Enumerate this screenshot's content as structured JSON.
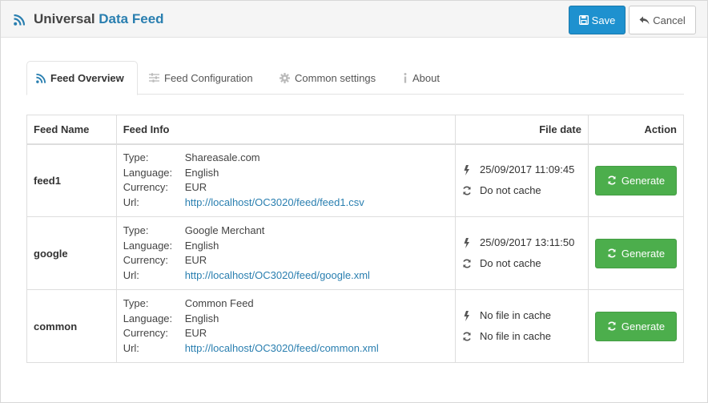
{
  "header": {
    "title_main": "Universal",
    "title_accent": "Data Feed",
    "save_label": "Save",
    "cancel_label": "Cancel"
  },
  "tabs": [
    {
      "label": "Feed Overview",
      "icon": "rss-icon",
      "active": true
    },
    {
      "label": "Feed Configuration",
      "icon": "sliders-icon",
      "active": false
    },
    {
      "label": "Common settings",
      "icon": "gear-icon",
      "active": false
    },
    {
      "label": "About",
      "icon": "info-icon",
      "active": false
    }
  ],
  "table": {
    "columns": [
      "Feed Name",
      "Feed Info",
      "File date",
      "Action"
    ],
    "info_labels": {
      "type": "Type:",
      "language": "Language:",
      "currency": "Currency:",
      "url": "Url:"
    },
    "generate_label": "Generate",
    "rows": [
      {
        "name": "feed1",
        "type": "Shareasale.com",
        "language": "English",
        "currency": "EUR",
        "url": "http://localhost/OC3020/feed/feed1.csv",
        "file_date": "25/09/2017 11:09:45",
        "cache": "Do not cache"
      },
      {
        "name": "google",
        "type": "Google Merchant",
        "language": "English",
        "currency": "EUR",
        "url": "http://localhost/OC3020/feed/google.xml",
        "file_date": "25/09/2017 13:11:50",
        "cache": "Do not cache"
      },
      {
        "name": "common",
        "type": "Common Feed",
        "language": "English",
        "currency": "EUR",
        "url": "http://localhost/OC3020/feed/common.xml",
        "file_date": "No file in cache",
        "cache": "No file in cache"
      }
    ]
  },
  "colors": {
    "accent": "#2a7fb0",
    "save_button": "#1e91cf",
    "generate_button": "#4cae4c"
  }
}
